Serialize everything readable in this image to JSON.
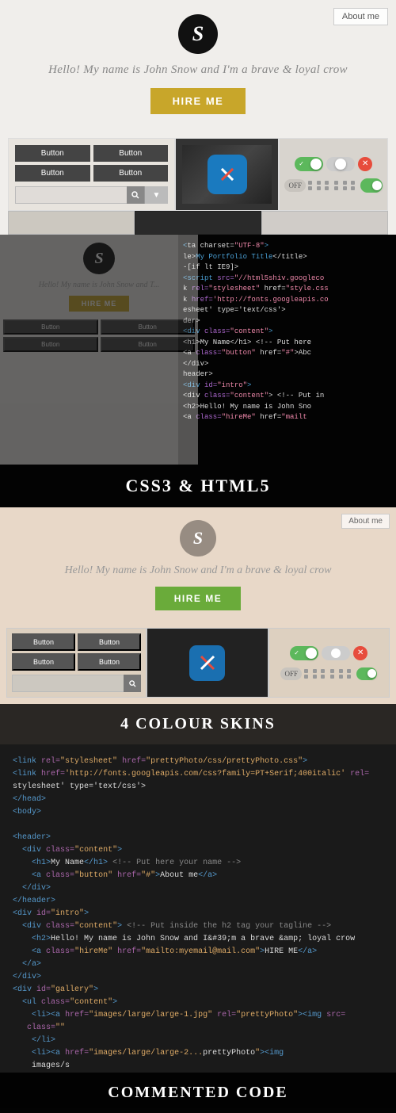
{
  "header": {
    "logo_letter": "S",
    "about_me_label": "About me"
  },
  "hero": {
    "tagline": "Hello! My name is John Snow and I'm a brave & loyal crow",
    "hire_btn_label": "HIRE ME"
  },
  "preview": {
    "btn1": "Button",
    "btn2": "Button",
    "btn3": "Button",
    "btn4": "Button",
    "search_placeholder": "",
    "toggle_off_label": "OFF",
    "toggle_on_check": "✓",
    "toggle_x": "✕"
  },
  "feature1": {
    "label": "CSS3 & HTML5",
    "code_lines": [
      "<ta charset=\"UTF-8\">",
      "le>My Portfolio Title</title>",
      "-[if lt IE9]>",
      "<script src=\"//html5shiv.googleco",
      "k rel=\"stylesheet\" href=\"style.css",
      "k href=\"http://fonts.googleapis.co",
      "esheet' type='text/css'>",
      "der>",
      "<div class=\"content\">",
      "  <h1>My Name</h1> <!-- Put here",
      "  <a class=\"button\" href=\"#\">Abc",
      "</div>",
      "header>",
      "<div id=\"intro\">",
      "  <div class=\"content\"> <!-- Put in",
      "    <h2>Hello! My name is John Sno",
      "    <a class=\"hireMe\" href=\"mailt",
      ""
    ]
  },
  "feature2": {
    "label": "4 COLOUR SKINS",
    "tagline": "Hello! My name is John Snow and I'm a brave & loyal crow",
    "hire_btn_label": "HIRE ME"
  },
  "feature3": {
    "label": "COMMENTED CODE",
    "code_lines": [
      "<link rel=\"stylesheet\" href=\"prettyPhoto/css/prettyPhoto.css\">",
      "<link href='http://fonts.googleapis.com/css?family=PT+Serif;400italic' rel=",
      "stylesheet' type='text/css'>",
      "</head>",
      "<body>",
      "",
      "<header>",
      "  <div class=\"content\">",
      "    <h1>My Name</h1> <!-- Put here your name -->",
      "    <a class=\"button\" href=\"#\">About me</a>",
      "  </div>",
      "</header>",
      "<div id=\"intro\">",
      "  <div class=\"content\"> <!-- Put inside the h2 tag your tagline -->",
      "    <h2>Hello! My name is John Snow and I&#39;m a brave &amp; loyal crow",
      "    <a class=\"hireMe\" href=\"mailto:myemail@mail.com\">HIRE ME</a>",
      "  </a>",
      "</div>",
      "<div id=\"gallery\">",
      "  <ul class=\"content\">",
      "    <li><a href=\"images/large/large-1.jpg\" rel=\"prettyPhoto\"><img src=",
      "   class=\"\"",
      "    </li>",
      "    <li><a href=\"images/large/large-2...prettyPhoto\"><img",
      "    images/s"
    ]
  }
}
